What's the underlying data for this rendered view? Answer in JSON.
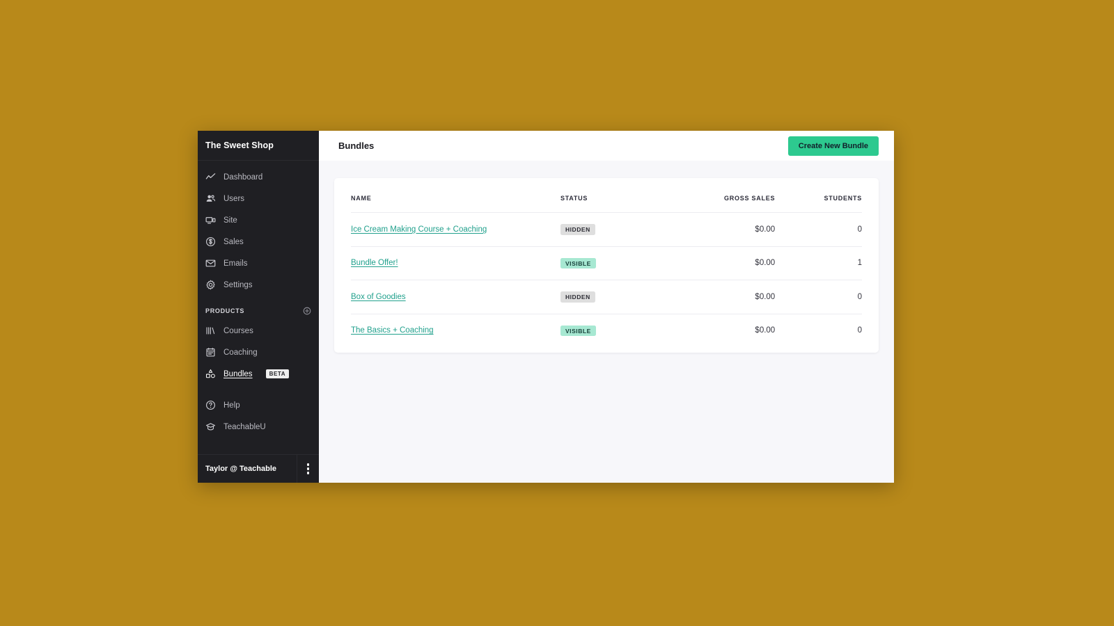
{
  "sidebar": {
    "brand": "The Sweet Shop",
    "nav": [
      {
        "label": "Dashboard",
        "icon": "trend-line-icon"
      },
      {
        "label": "Users",
        "icon": "people-icon"
      },
      {
        "label": "Site",
        "icon": "monitor-icon"
      },
      {
        "label": "Sales",
        "icon": "dollar-circle-icon"
      },
      {
        "label": "Emails",
        "icon": "envelope-icon"
      },
      {
        "label": "Settings",
        "icon": "gear-icon"
      }
    ],
    "products_label": "PRODUCTS",
    "add_product_icon": "plus-circle-icon",
    "products": [
      {
        "label": "Courses",
        "icon": "books-icon",
        "active": false,
        "badge": ""
      },
      {
        "label": "Coaching",
        "icon": "notepad-icon",
        "active": false,
        "badge": ""
      },
      {
        "label": "Bundles",
        "icon": "shapes-icon",
        "active": true,
        "badge": "BETA"
      }
    ],
    "support": [
      {
        "label": "Help",
        "icon": "question-circle-icon"
      },
      {
        "label": "TeachableU",
        "icon": "graduation-cap-icon"
      }
    ],
    "footer_user": "Taylor @ Teachable",
    "footer_menu_icon": "kebab-menu-icon"
  },
  "header": {
    "title": "Bundles",
    "create_button": "Create New Bundle"
  },
  "table": {
    "columns": [
      "NAME",
      "STATUS",
      "GROSS SALES",
      "STUDENTS"
    ],
    "rows": [
      {
        "name": "Ice Cream Making Course + Coaching",
        "status": "HIDDEN",
        "gross_sales": "$0.00",
        "students": "0"
      },
      {
        "name": "Bundle Offer!",
        "status": "VISIBLE",
        "gross_sales": "$0.00",
        "students": "1"
      },
      {
        "name": "Box of Goodies",
        "status": "HIDDEN",
        "gross_sales": "$0.00",
        "students": "0"
      },
      {
        "name": "The Basics + Coaching",
        "status": "VISIBLE",
        "gross_sales": "$0.00",
        "students": "0"
      }
    ]
  },
  "colors": {
    "page_background": "#b8891a",
    "sidebar": "#1f1f23",
    "accent_green": "#2dc98f",
    "link_teal": "#20a08c",
    "badge_hidden": "#dedede",
    "badge_visible": "#a7e8d2"
  }
}
